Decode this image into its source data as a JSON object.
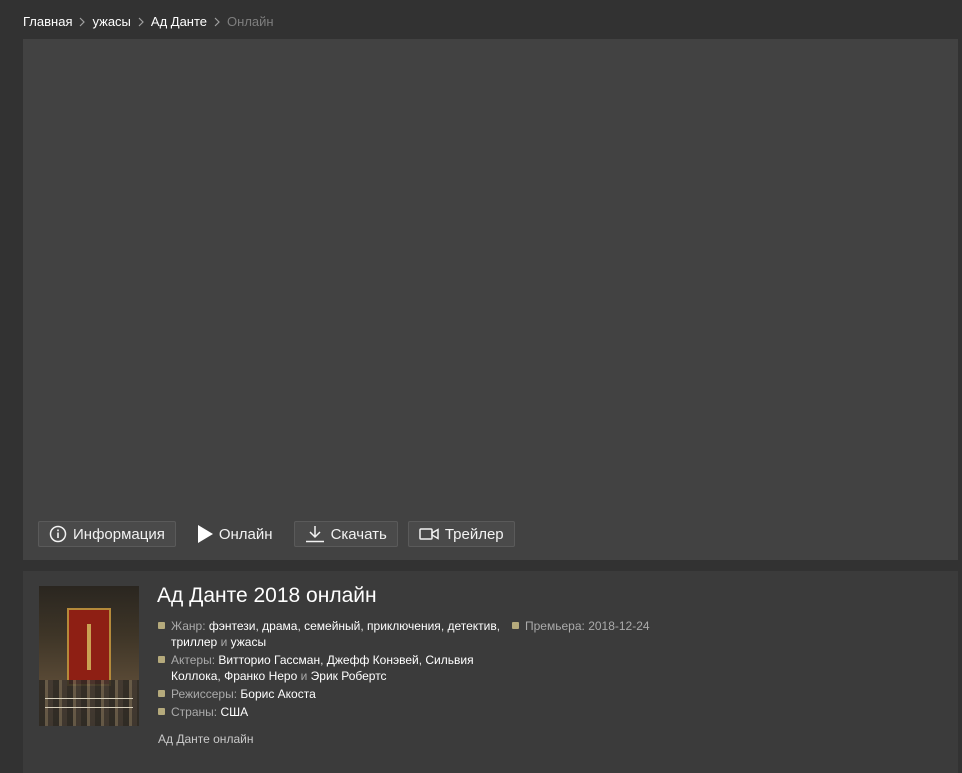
{
  "breadcrumb": {
    "items": [
      "Главная",
      "ужасы",
      "Ад Данте"
    ],
    "current": "Онлайн"
  },
  "player": {
    "tabs": [
      {
        "label": "Информация",
        "icon": "info-icon"
      },
      {
        "label": "Онлайн",
        "icon": "play-icon"
      },
      {
        "label": "Скачать",
        "icon": "download-icon"
      },
      {
        "label": "Трейлер",
        "icon": "video-camera-icon"
      }
    ],
    "active_tab": "Онлайн"
  },
  "movie": {
    "title": "Ад Данте 2018 онлайн",
    "genre_label": "Жанр:",
    "genres": [
      "фэнтези",
      "драма",
      "семейный",
      "приключения",
      "детектив",
      "триллер",
      "ужасы"
    ],
    "actors_label": "Актеры:",
    "actors": [
      "Витторио Гассман",
      "Джефф Конэвей",
      "Сильвия Коллока",
      "Франко Неро",
      "Эрик Робертс"
    ],
    "directors_label": "Режиссеры:",
    "directors": [
      "Борис Акоста"
    ],
    "countries_label": "Страны:",
    "countries": [
      "США"
    ],
    "premiere_label": "Премьера:",
    "premiere": "2018-12-24",
    "tagline": "Ад Данте онлайн",
    "list_separator": ",",
    "list_conjunction": "и"
  },
  "colors": {
    "page_bg": "#323232",
    "player_bg": "#424242",
    "info_bg": "#3b3b3b",
    "bullet": "#b5aa7c"
  }
}
